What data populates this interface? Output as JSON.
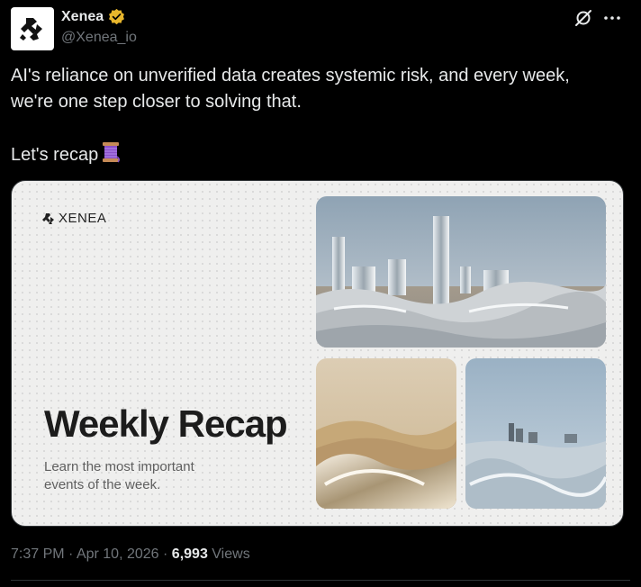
{
  "author": {
    "display_name": "Xenea",
    "handle": "@Xenea_io",
    "verified": true,
    "verified_color": "#e8b62c",
    "avatar_icon": "xenea-logo-icon"
  },
  "header_actions": {
    "grok_icon": "grok-icon",
    "more_icon": "more-icon"
  },
  "tweet": {
    "line1": "AI's reliance on unverified data creates systemic risk, and every week,",
    "line2": "we're one step closer to solving that.",
    "line3": "Let's recap",
    "emoji": "thread-spool-icon"
  },
  "media_card": {
    "brand": "XENEA",
    "title": "Weekly Recap",
    "subtitle": "Learn the most important events of the week."
  },
  "meta": {
    "time": "7:37 PM",
    "separator": "·",
    "date": "Apr 10, 2026",
    "views_count": "6,993",
    "views_label": "Views"
  },
  "colors": {
    "background": "#000000",
    "text_primary": "#e7e9ea",
    "text_secondary": "#71767b",
    "border": "#2f3336"
  }
}
